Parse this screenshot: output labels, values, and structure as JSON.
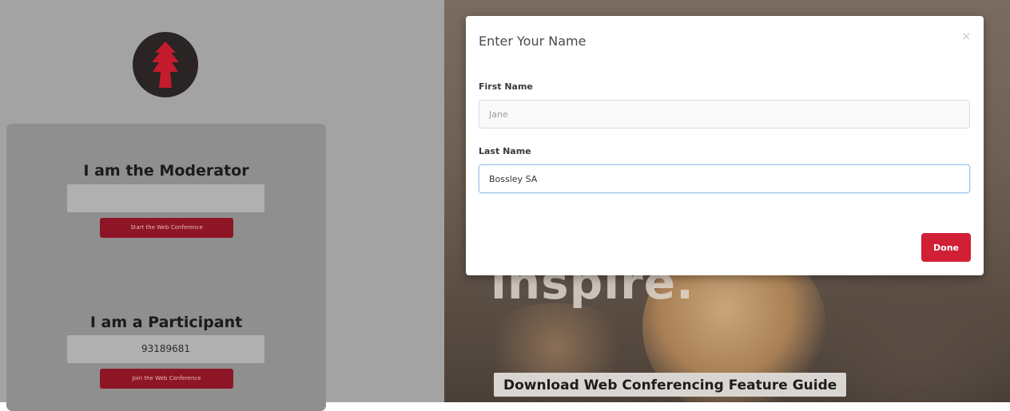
{
  "moderator": {
    "title": "I am the Moderator",
    "code_value": "",
    "button_label": "Start the Web Conference"
  },
  "participant": {
    "title": "I am a Participant",
    "code_value": "93189681",
    "button_label": "Join the Web Conference"
  },
  "hero": {
    "text": "inspire.",
    "download_label": "Download Web Conferencing Feature Guide"
  },
  "modal": {
    "title": "Enter Your Name",
    "close_glyph": "×",
    "first_name": {
      "label": "First Name",
      "placeholder": "Jane",
      "value": ""
    },
    "last_name": {
      "label": "Last Name",
      "value": "Bossley SA"
    },
    "done_label": "Done"
  },
  "colors": {
    "overlay_gray": "#a3a3a3",
    "brand_red": "#8e1525",
    "done_red": "#d11f35",
    "focus_border": "#9ec7ec"
  },
  "icons": {
    "logo": "red-tree-emblem-icon",
    "close": "close-icon"
  }
}
